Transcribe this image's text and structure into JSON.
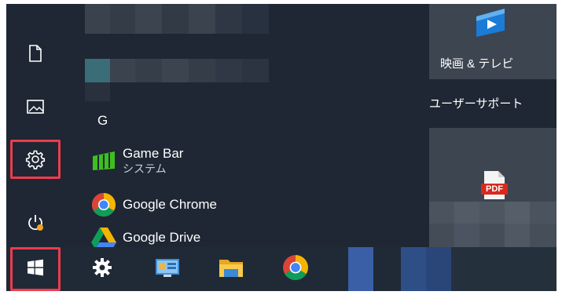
{
  "app_list": {
    "group_letter": "G",
    "items": [
      {
        "name": "Game Bar",
        "subtitle": "システム",
        "icon": "game-bar-icon"
      },
      {
        "name": "Google Chrome",
        "icon": "chrome-icon"
      },
      {
        "name": "Google Drive",
        "icon": "google-drive-icon"
      }
    ]
  },
  "left_rail": [
    {
      "icon": "document-icon",
      "highlighted": false
    },
    {
      "icon": "pictures-icon",
      "highlighted": false
    },
    {
      "icon": "gear-icon",
      "highlighted": true
    },
    {
      "icon": "power-icon",
      "highlighted": false
    }
  ],
  "tiles": {
    "movies_tv": {
      "label": "映画 & テレビ",
      "icon": "play-icon"
    },
    "group_title": "ユーザーサポート",
    "pdf_tile": {
      "badge": "PDF",
      "icon": "pdf-icon"
    }
  },
  "taskbar": {
    "start_highlighted": true,
    "items": [
      "windows-logo-icon",
      "gear-icon",
      "control-panel-icon",
      "file-explorer-icon",
      "chrome-icon"
    ]
  },
  "colors": {
    "background": "#1e2733",
    "highlight": "#ee3b4d",
    "tile": "#3c4550",
    "accent_blue": "#1b7bd6"
  }
}
